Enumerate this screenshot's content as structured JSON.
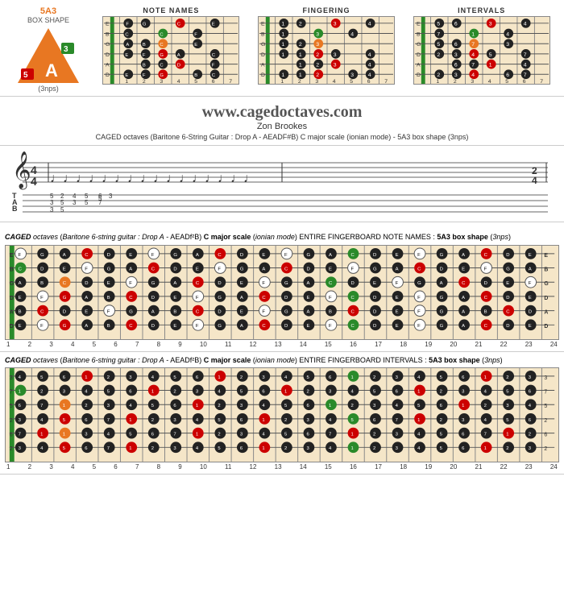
{
  "top": {
    "shape_title": "5A3",
    "shape_subtitle": "BOX SHAPE",
    "shape_letter": "A",
    "shape_nps": "(3nps)",
    "diagrams": [
      {
        "title": "NOTE NAMES"
      },
      {
        "title": "FINGERING"
      },
      {
        "title": "INTERVALS"
      }
    ]
  },
  "website": {
    "url": "www.cagedoctaves.com",
    "author": "Zon Brookes",
    "description": "CAGED octaves (Baritone 6-String Guitar : Drop A - AEADF#B) C major scale (ionian mode) - 5A3 box shape (3nps)"
  },
  "fingerboard_notes": {
    "header": "CAGED octaves (Baritone 6-string guitar : Drop A - AEADF²B) C major scale (ionian mode) ENTIRE FINGERBOARD NOTE NAMES : 5A3 box shape (3nps)",
    "fret_numbers": [
      "1",
      "2",
      "3",
      "4",
      "5",
      "6",
      "7",
      "8",
      "9",
      "10",
      "11",
      "12",
      "13",
      "14",
      "15",
      "16",
      "17",
      "18",
      "19",
      "20",
      "21",
      "22",
      "23",
      "24"
    ]
  },
  "fingerboard_intervals": {
    "header": "CAGED octaves (Baritone 6-string guitar : Drop A - AEADF²B) C major scale (ionian mode) ENTIRE FINGERBOARD INTERVALS : 5A3 box shape (3nps)",
    "fret_numbers": [
      "1",
      "2",
      "3",
      "4",
      "5",
      "6",
      "7",
      "8",
      "9",
      "10",
      "11",
      "12",
      "13",
      "14",
      "15",
      "16",
      "17",
      "18",
      "19",
      "20",
      "21",
      "22",
      "23",
      "24"
    ]
  },
  "caged_label": "CAGED"
}
